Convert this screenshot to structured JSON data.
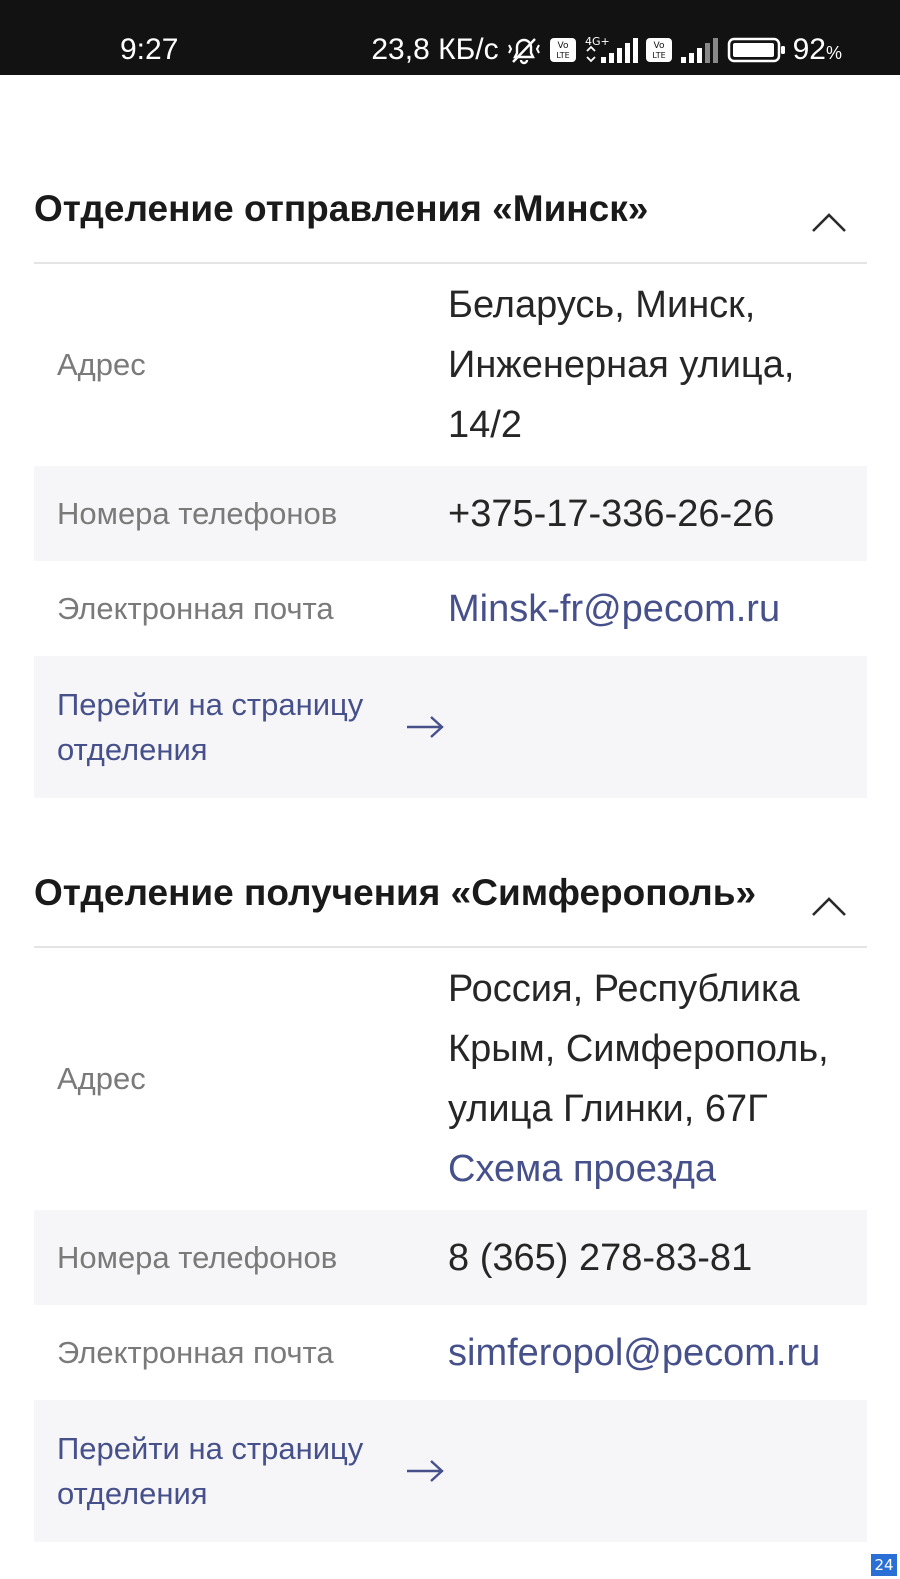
{
  "status_bar": {
    "time": "9:27",
    "network_speed": "23,8 КБ/с",
    "network_type": "4G+",
    "battery_percent": "92",
    "battery_unit": "%",
    "icons": [
      "mute-icon",
      "volte-icon",
      "signal-icon",
      "volte-icon",
      "signal-icon",
      "battery-icon"
    ]
  },
  "sections": [
    {
      "title": "Отделение отправления «Минск»",
      "address_label": "Адрес",
      "address_lines": [
        "Беларусь, Минск,",
        "Инженерная улица,",
        "14/2"
      ],
      "phones_label": "Номера телефонов",
      "phones_value": "+375-17-336-26-26",
      "email_label": "Электронная почта",
      "email_value": "Minsk-fr@pecom.ru",
      "link_text_line1": "Перейти на страницу",
      "link_text_line2": "отделения"
    },
    {
      "title": "Отделение получения «Симферополь»",
      "address_label": "Адрес",
      "address_lines": [
        "Россия, Республика",
        "Крым, Симферополь,",
        "улица Глинки, 67Г"
      ],
      "route_link": "Схема проезда",
      "phones_label": "Номера телефонов",
      "phones_value": "8 (365) 278-83-81",
      "email_label": "Электронная почта",
      "email_value": "simferopol@pecom.ru",
      "link_text_line1": "Перейти на страницу",
      "link_text_line2": "отделения"
    }
  ],
  "corner_badge": "24",
  "colors": {
    "link": "#46508a",
    "shaded_row": "#f6f6f8",
    "status_bar": "#121212"
  }
}
